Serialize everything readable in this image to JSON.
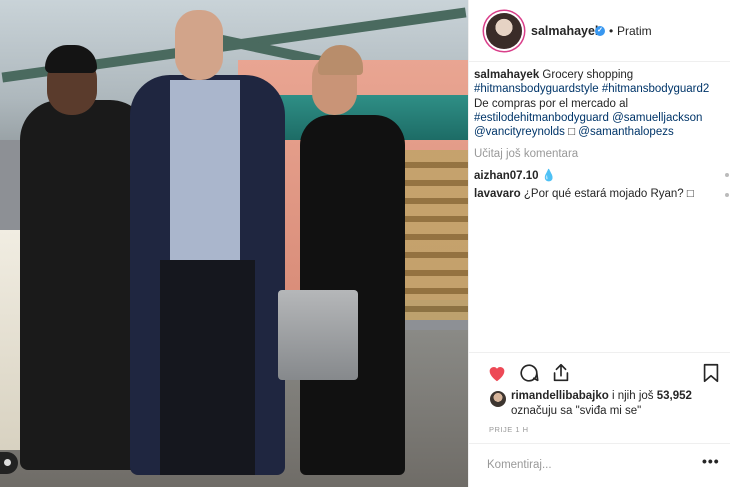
{
  "post": {
    "username": "salmahayek",
    "follow_separator": "•",
    "follow_status": "Pratim",
    "caption_user": "salmahayek",
    "caption_line1": "Grocery shopping",
    "caption_line2": "#hitmansbodyguardstyle #hitmansbodyguard2",
    "caption_line3": "De compras por el mercado al",
    "caption_line4": "#estilodehitmanbodyguard @samuelljackson",
    "caption_line5_a": "@vancityreynolds",
    "caption_line5_glyph": "□",
    "caption_line5_b": "@samanthalopezs",
    "load_more": "Učitaj još komentara",
    "comments": [
      {
        "user": "aizhan07.10",
        "text": "💧"
      },
      {
        "user": "lavavaro",
        "text": "¿Por qué estará mojado Ryan? □"
      }
    ],
    "liked_by_user": "rimandellibabajko",
    "liked_by_mid": " i njih još ",
    "likes_count": "53,952",
    "likes_line2": "označuju sa \"sviđa mi se\"",
    "time": "PRIJE 1 H",
    "comment_placeholder": "Komentiraj...",
    "more_options": "•••"
  },
  "icons": {
    "heart": "heart-icon",
    "comment": "comment-icon",
    "share": "share-icon",
    "bookmark": "bookmark-icon",
    "verified": "verified-badge-icon"
  },
  "colors": {
    "heart": "#ed4956",
    "verified": "#3897f0",
    "hashtag": "#003569",
    "muted": "#999999",
    "story_ring": "#d93f8a"
  }
}
